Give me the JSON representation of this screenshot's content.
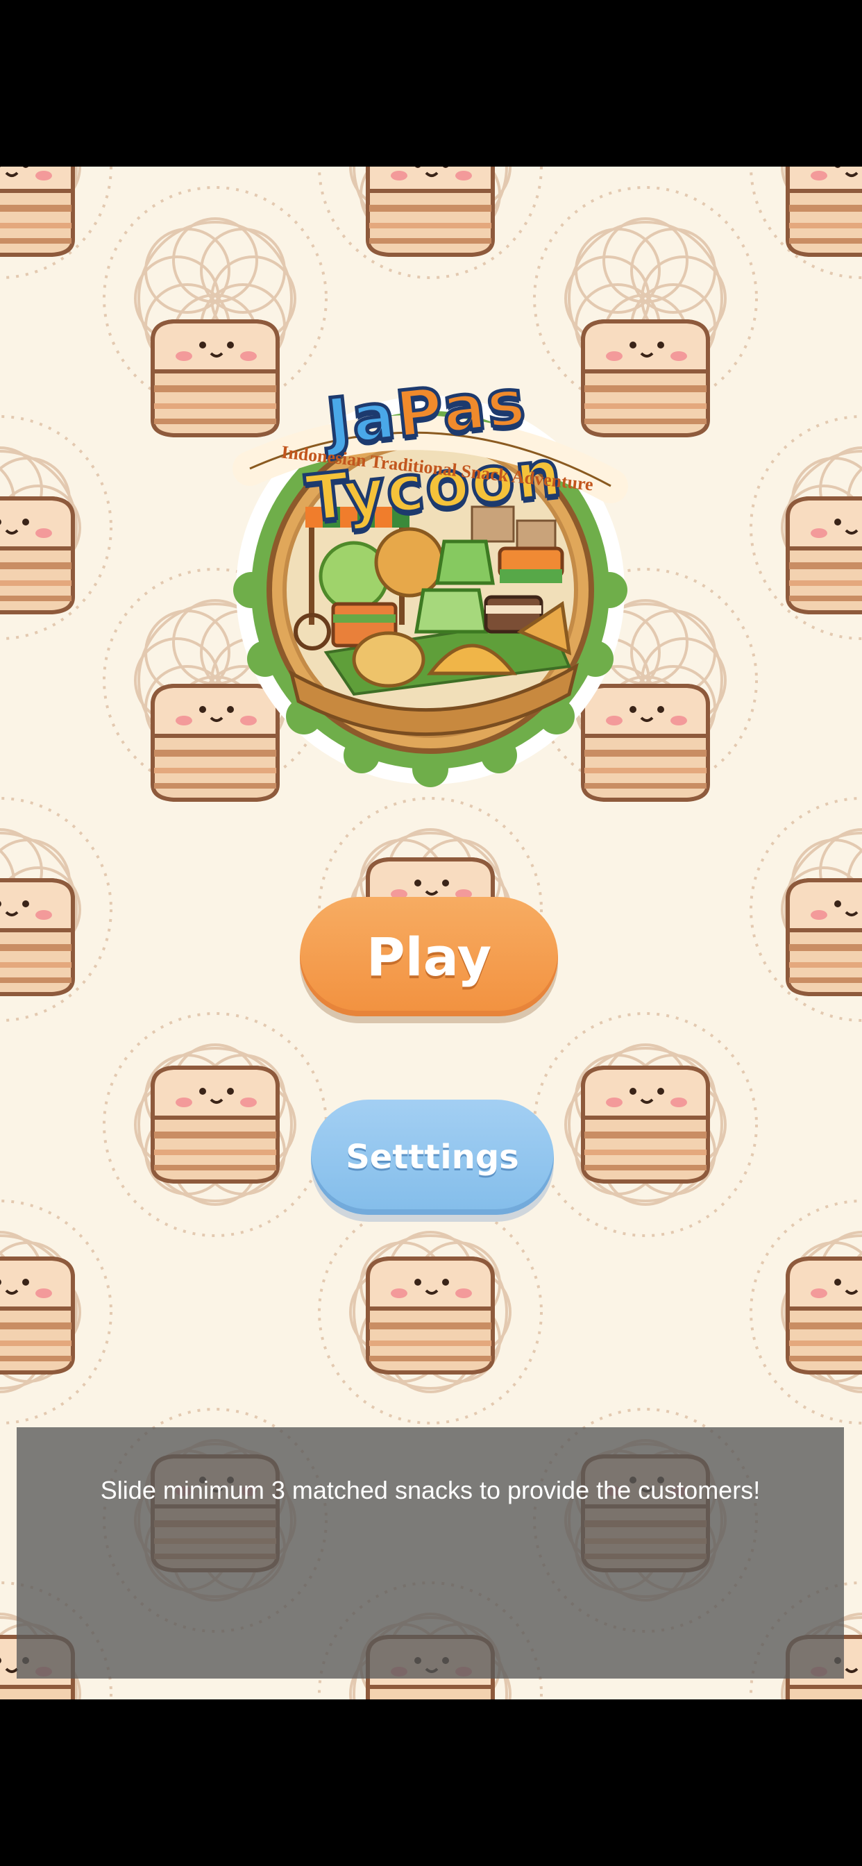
{
  "logo": {
    "title_part1": "Ja",
    "title_part2": "Pas",
    "title_part3": " Tycoon",
    "subtitle": "Indonesian Traditional Snack Adventure"
  },
  "buttons": {
    "play": "Play",
    "settings": "Setttings"
  },
  "toast": {
    "message": "Slide minimum 3 matched snacks to provide the customers!"
  },
  "colors": {
    "background": "#fbf4e6",
    "play_button": "#f49a4a",
    "settings_button": "#8fc4ee",
    "toast_overlay": "#585858"
  },
  "icons": [
    "layer-cake-icon",
    "batik-pattern-icon",
    "snack-basket-icon"
  ]
}
